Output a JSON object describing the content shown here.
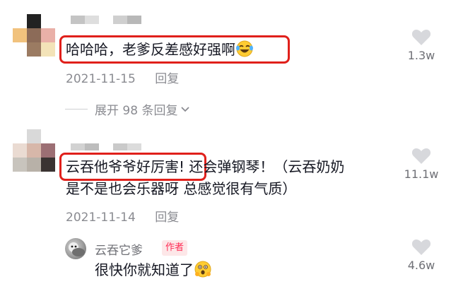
{
  "comments": [
    {
      "text_part1": "哈哈哈，老爹反差感好强啊",
      "text_part2": "",
      "text_line2": "",
      "date": "2021-11-15",
      "reply_label": "回复",
      "likes": "1.3w"
    },
    {
      "text_part1": "云吞他爷爷好厉害!",
      "text_part2": " 还会弹钢琴！（云吞奶奶",
      "text_line2": "是不是也会乐器呀 总感觉很有气质）",
      "date": "2021-11-14",
      "reply_label": "回复",
      "likes": "11.1w"
    }
  ],
  "expand_replies": "展开 98 条回复",
  "author_reply": {
    "name": "云吞它爹",
    "badge": "作者",
    "text": "很快你就知道了",
    "likes": "4.6w"
  },
  "colors": {
    "highlight": "#e0201b",
    "badge_text": "#fe2c55",
    "badge_bg": "#fde7e8",
    "meta": "#8a8b91"
  },
  "icons": [
    "heart-icon",
    "laughing-crying-emoji",
    "chevron-down-icon",
    "surprised-emoji"
  ]
}
